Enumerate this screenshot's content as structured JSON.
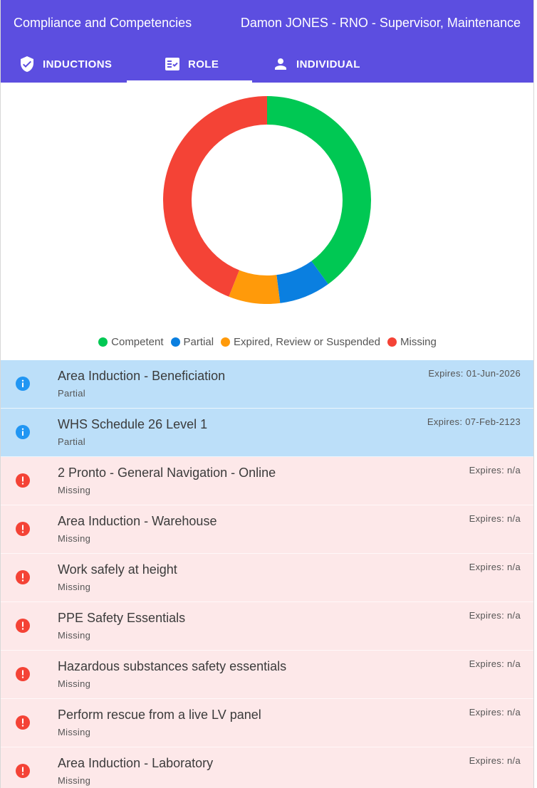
{
  "header": {
    "title": "Compliance and Competencies",
    "user": "Damon JONES - RNO - Supervisor, Maintenance"
  },
  "tabs": [
    {
      "label": "INDUCTIONS",
      "icon": "shield-check-icon",
      "active": false
    },
    {
      "label": "ROLE",
      "icon": "checklist-icon",
      "active": true
    },
    {
      "label": "INDIVIDUAL",
      "icon": "person-icon",
      "active": false
    }
  ],
  "chart_data": {
    "type": "pie",
    "variant": "donut",
    "title": "",
    "categories": [
      "Competent",
      "Partial",
      "Expired, Review or Suspended",
      "Missing"
    ],
    "values": [
      2,
      0.4,
      0.4,
      2.2
    ],
    "colors": [
      "#00c853",
      "#0a7fe0",
      "#ff9a0a",
      "#f44336"
    ],
    "legend_position": "bottom"
  },
  "expiry_label": "Expires:",
  "items": [
    {
      "name": "Area Induction - Beneficiation",
      "status": "Partial",
      "expiry": "01-Jun-2026",
      "type": "partial",
      "icon": "info-icon"
    },
    {
      "name": "WHS Schedule 26 Level 1",
      "status": "Partial",
      "expiry": "07-Feb-2123",
      "type": "partial",
      "icon": "info-icon"
    },
    {
      "name": "2 Pronto - General Navigation - Online",
      "status": "Missing",
      "expiry": "n/a",
      "type": "missing",
      "icon": "alert-icon"
    },
    {
      "name": "Area Induction - Warehouse",
      "status": "Missing",
      "expiry": "n/a",
      "type": "missing",
      "icon": "alert-icon"
    },
    {
      "name": "Work safely at height",
      "status": "Missing",
      "expiry": "n/a",
      "type": "missing",
      "icon": "alert-icon"
    },
    {
      "name": "PPE Safety Essentials",
      "status": "Missing",
      "expiry": "n/a",
      "type": "missing",
      "icon": "alert-icon"
    },
    {
      "name": "Hazardous substances safety essentials",
      "status": "Missing",
      "expiry": "n/a",
      "type": "missing",
      "icon": "alert-icon"
    },
    {
      "name": "Perform rescue from a live LV panel",
      "status": "Missing",
      "expiry": "n/a",
      "type": "missing",
      "icon": "alert-icon"
    },
    {
      "name": "Area Induction - Laboratory",
      "status": "Missing",
      "expiry": "n/a",
      "type": "missing",
      "icon": "alert-icon"
    }
  ],
  "colors": {
    "header": "#5c4ee0",
    "partial_row": "#bcdff9",
    "missing_row": "#fde8e9",
    "info": "#2196f3",
    "alert": "#f44336"
  }
}
